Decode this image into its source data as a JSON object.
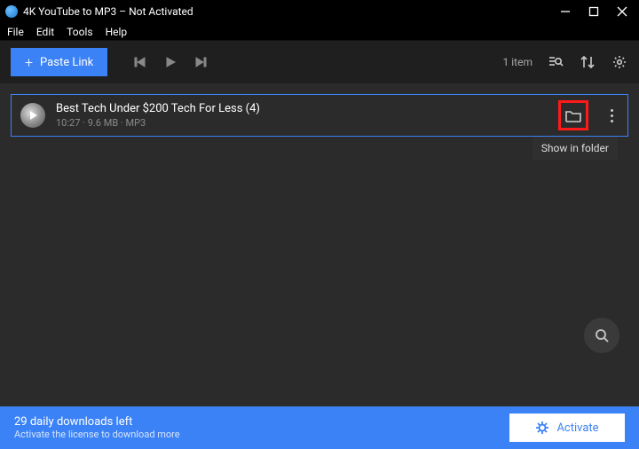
{
  "window": {
    "title": "4K YouTube to MP3 – Not Activated"
  },
  "menu": {
    "file": "File",
    "edit": "Edit",
    "tools": "Tools",
    "help": "Help"
  },
  "toolbar": {
    "paste_label": "Paste Link",
    "item_count": "1 item"
  },
  "item": {
    "title": "Best Tech Under $200  Tech For Less (4)",
    "meta": "10:27 · 9.6 MB · MP3"
  },
  "tooltip": {
    "folder": "Show in folder"
  },
  "footer": {
    "title": "29 daily downloads left",
    "sub": "Activate the license to download more",
    "activate_label": "Activate"
  }
}
